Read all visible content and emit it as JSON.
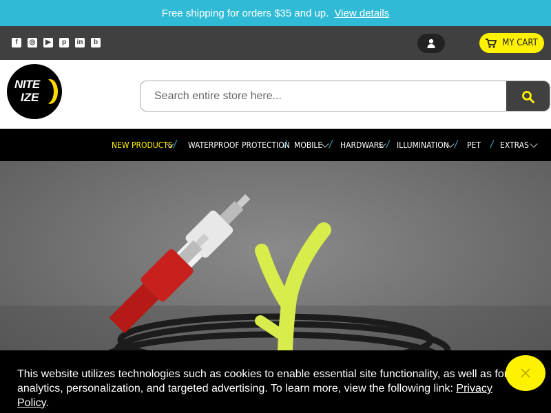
{
  "promo": {
    "text": "Free shipping for orders $35 and up.",
    "link": "View details"
  },
  "topbar": {
    "social": [
      {
        "name": "facebook-icon",
        "glyph": "f"
      },
      {
        "name": "instagram-icon",
        "glyph": "◎"
      },
      {
        "name": "youtube-icon",
        "glyph": "▶"
      },
      {
        "name": "pinterest-icon",
        "glyph": "p"
      },
      {
        "name": "linkedin-icon",
        "glyph": "in"
      },
      {
        "name": "blog-icon",
        "glyph": "b"
      }
    ],
    "account_icon": "user-icon",
    "cart_label": "MY CART",
    "cart_icon": "shopping-cart-icon"
  },
  "header": {
    "logo_line1": "NITE",
    "logo_line2": "IZE",
    "search_placeholder": "Search entire store here...",
    "search_icon": "search-icon"
  },
  "nav": {
    "items": [
      {
        "label": "NEW PRODUCTS",
        "active": true
      },
      {
        "label": "WATERPROOF PROTECTION"
      },
      {
        "label": "MOBILE"
      },
      {
        "label": "HARDWARE"
      },
      {
        "label": "ILLUMINATION"
      },
      {
        "label": "PET"
      },
      {
        "label": "EXTRAS"
      }
    ],
    "separator": "/"
  },
  "hero": {
    "image": "rca-audio-cable-with-green-twist-tie"
  },
  "cookie": {
    "text": "This website utilizes technologies such as cookies to enable essential site functionality, as well as for analytics, personalization, and targeted advertising. To learn more, view the following link:",
    "link": "Privacy Policy",
    "after": "."
  },
  "colors": {
    "promo": "#2fbbd6",
    "accent": "#fff200",
    "topbar": "#404040",
    "nav": "#000000"
  }
}
